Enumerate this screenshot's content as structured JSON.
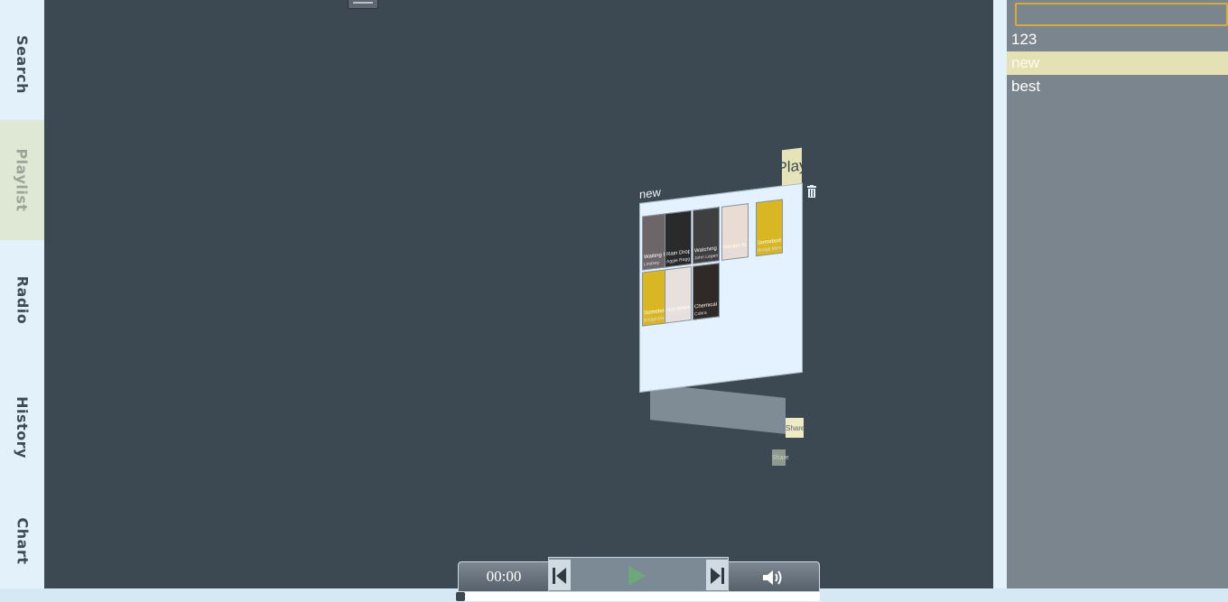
{
  "nav": {
    "tabs": [
      {
        "label": "Search",
        "active": false
      },
      {
        "label": "Playlist",
        "active": true
      },
      {
        "label": "Radio",
        "active": false
      },
      {
        "label": "History",
        "active": false
      },
      {
        "label": "Chart",
        "active": false
      }
    ]
  },
  "playlists_panel": {
    "search_value": "",
    "items": [
      {
        "label": "123",
        "selected": false
      },
      {
        "label": "new",
        "selected": true
      },
      {
        "label": "best",
        "selected": false
      }
    ]
  },
  "playlist_card": {
    "title": "new",
    "play_label": "Play",
    "share_label": "Share",
    "share_label_2": "Share",
    "tracks": [
      {
        "title": "Waiting For It",
        "artist": "Lindsey",
        "bg": "#6d6668"
      },
      {
        "title": "Rain Drops",
        "artist": "Aggie Ragge Pro",
        "bg": "#2a2a2a"
      },
      {
        "title": "Watching T",
        "artist": "John Legend",
        "bg": "#3f3f3f"
      },
      {
        "title": "Recipe for Hate",
        "artist": "Bridget Mendler",
        "bg": "#e9dcd2"
      },
      {
        "title": "Somebody",
        "artist": "Bridgit Mendler",
        "bg": "#d9b724"
      },
      {
        "title": "Somebody",
        "artist": "Bridgit Mendler",
        "bg": "#d9b724"
      },
      {
        "title": "Hot Wheels",
        "artist": "Various Artist",
        "bg": "#e8e0dc"
      },
      {
        "title": "Chemical Reaction",
        "artist": "Cobra",
        "bg": "#2f2a26"
      }
    ]
  },
  "player": {
    "time": "00:00",
    "progress": 0,
    "colors": {
      "play_green": "#6ea878",
      "accent": "#d5ab3c"
    }
  }
}
